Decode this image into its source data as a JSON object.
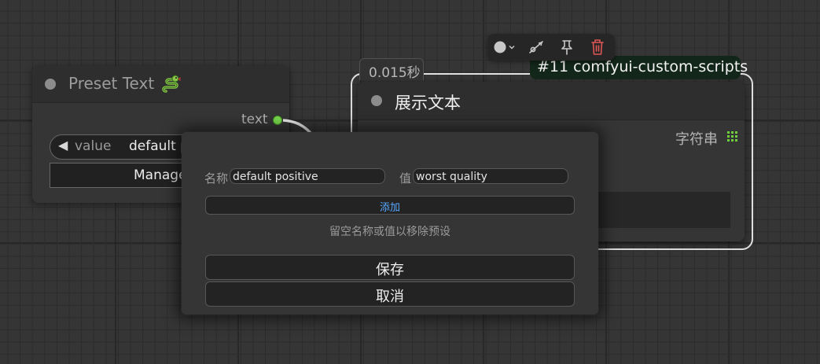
{
  "preset_node": {
    "title": "Preset Text",
    "output_label": "text",
    "value_widget": {
      "label": "value",
      "value": "default p"
    },
    "manage_button_label": "Manage"
  },
  "toolbar": {
    "icons": [
      "color-picker-icon",
      "chevron-down-icon",
      "bypass-icon",
      "pin-icon",
      "trash-icon"
    ]
  },
  "display_node": {
    "timing": "0.015秒",
    "id_badge": "#11 comfyui-custom-scripts",
    "title": "展示文本",
    "input_label": "字符串"
  },
  "dialog": {
    "name_label": "名称",
    "name_value": "default positive",
    "value_label": "值",
    "value_value": "worst quality",
    "add_label": "添加",
    "hint": "留空名称或值以移除预设",
    "save_label": "保存",
    "cancel_label": "取消"
  },
  "colors": {
    "canvas": "#353535",
    "output_slot": "#7bd94f",
    "link_accent": "#58a8ff",
    "trash": "#e05555",
    "id_badge_bg": "#13261a"
  }
}
